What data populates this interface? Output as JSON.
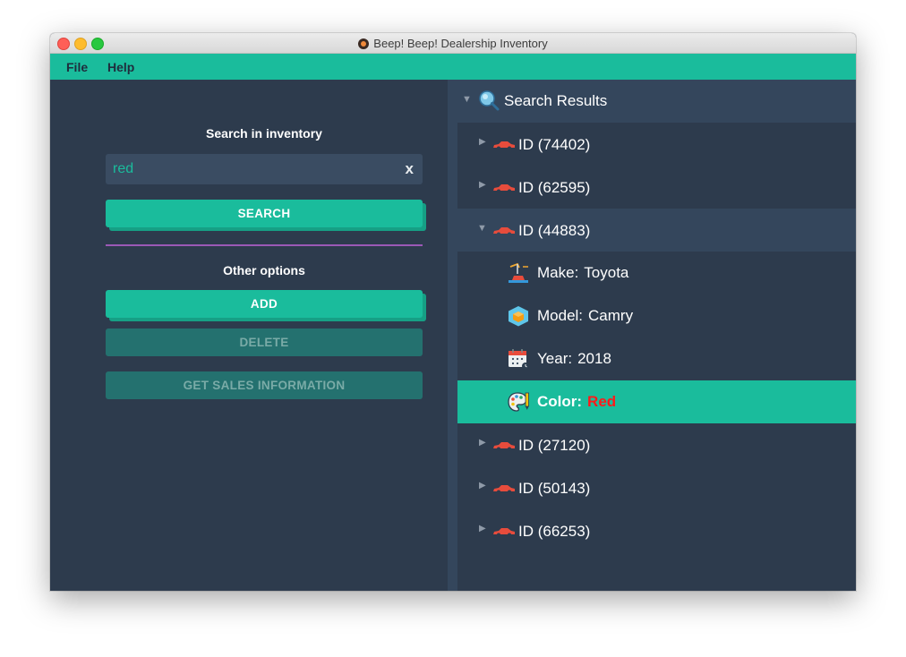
{
  "window": {
    "title": "Beep! Beep! Dealership Inventory"
  },
  "menu": {
    "file": "File",
    "help": "Help"
  },
  "left": {
    "search_heading": "Search in inventory",
    "search_value": "red",
    "clear_label": "x",
    "search_button": "SEARCH",
    "other_heading": "Other options",
    "add_button": "ADD",
    "delete_button": "DELETE",
    "sales_button": "GET SALES INFORMATION"
  },
  "tree": {
    "root_label": "Search Results",
    "items": [
      {
        "label": "ID (74402)"
      },
      {
        "label": "ID (62595)"
      },
      {
        "label": "ID (44883)"
      },
      {
        "label": "ID (27120)"
      },
      {
        "label": "ID (50143)"
      },
      {
        "label": "ID (66253)"
      }
    ],
    "expanded_details": {
      "make_label": "Make:",
      "make_value": "Toyota",
      "model_label": "Model:",
      "model_value": "Camry",
      "year_label": "Year:",
      "year_value": "2018",
      "color_label": "Color:",
      "color_value": "Red"
    }
  },
  "colors": {
    "accent": "#1abc9c",
    "pane_bg": "#2d3b4d",
    "highlight_value": "#ff1a1a",
    "separator": "#9b59b6"
  },
  "icons": {
    "search_results": "magnifier-icon",
    "vehicle": "red-car-icon",
    "make": "factory-icon",
    "model": "cube-icon",
    "year": "calendar-icon",
    "color": "palette-icon"
  }
}
